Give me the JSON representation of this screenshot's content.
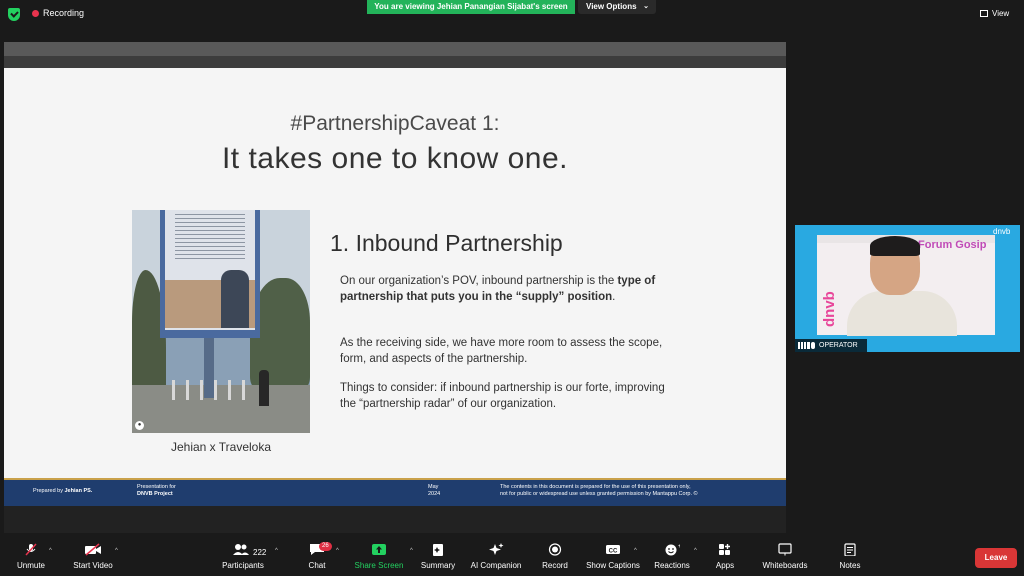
{
  "top_bar": {
    "recording_label": "Recording",
    "viewing_banner": "You are viewing Jehian Panangian Sijabat's screen",
    "view_options_label": "View Options",
    "view_label": "View"
  },
  "slide": {
    "subtitle": "#PartnershipCaveat 1:",
    "title": "It takes one to know one.",
    "photo_caption": "Jehian x Traveloka",
    "section_heading": "1. Inbound Partnership",
    "para1_pre": "On our organization’s POV, inbound partnership is the ",
    "para1_bold": "type of partnership that puts you in the “supply” position",
    "para1_post": ".",
    "para2": "As the receiving side, we have more room to assess the scope, form, and aspects of the partnership.",
    "para3": "Things to consider: if inbound partnership is our forte, improving the “partnership radar” of our organization.",
    "footer": {
      "prepared_prefix": "Prepared by ",
      "prepared_name": "Jehian PS.",
      "presentation_for": "Presentation for",
      "project": "DNVB Project",
      "month": "May",
      "year": "2024",
      "disclaimer_line1": "The contents in this document is prepared for the use of this presentation only,",
      "disclaimer_line2": "not for public or widespread use unless granted permission by Mantappu Corp. ©"
    }
  },
  "camera_tile": {
    "name": "OPERATOR",
    "brand": "dnvb",
    "overlay_title": "Forum Gosip",
    "side_brand": "dnvb"
  },
  "toolbar": {
    "unmute": "Unmute",
    "start_video": "Start Video",
    "participants": "Participants",
    "participants_count": "222",
    "chat": "Chat",
    "chat_badge": "26",
    "share_screen": "Share Screen",
    "summary": "Summary",
    "ai_companion": "AI Companion",
    "record": "Record",
    "show_captions": "Show Captions",
    "reactions": "Reactions",
    "apps": "Apps",
    "whiteboards": "Whiteboards",
    "notes": "Notes",
    "leave": "Leave"
  },
  "colors": {
    "accent_green": "#23d160",
    "recording_red": "#e8344e",
    "leave_red": "#d93636",
    "footer_navy": "#1f3d6e",
    "camera_blue": "#29a9e1"
  }
}
